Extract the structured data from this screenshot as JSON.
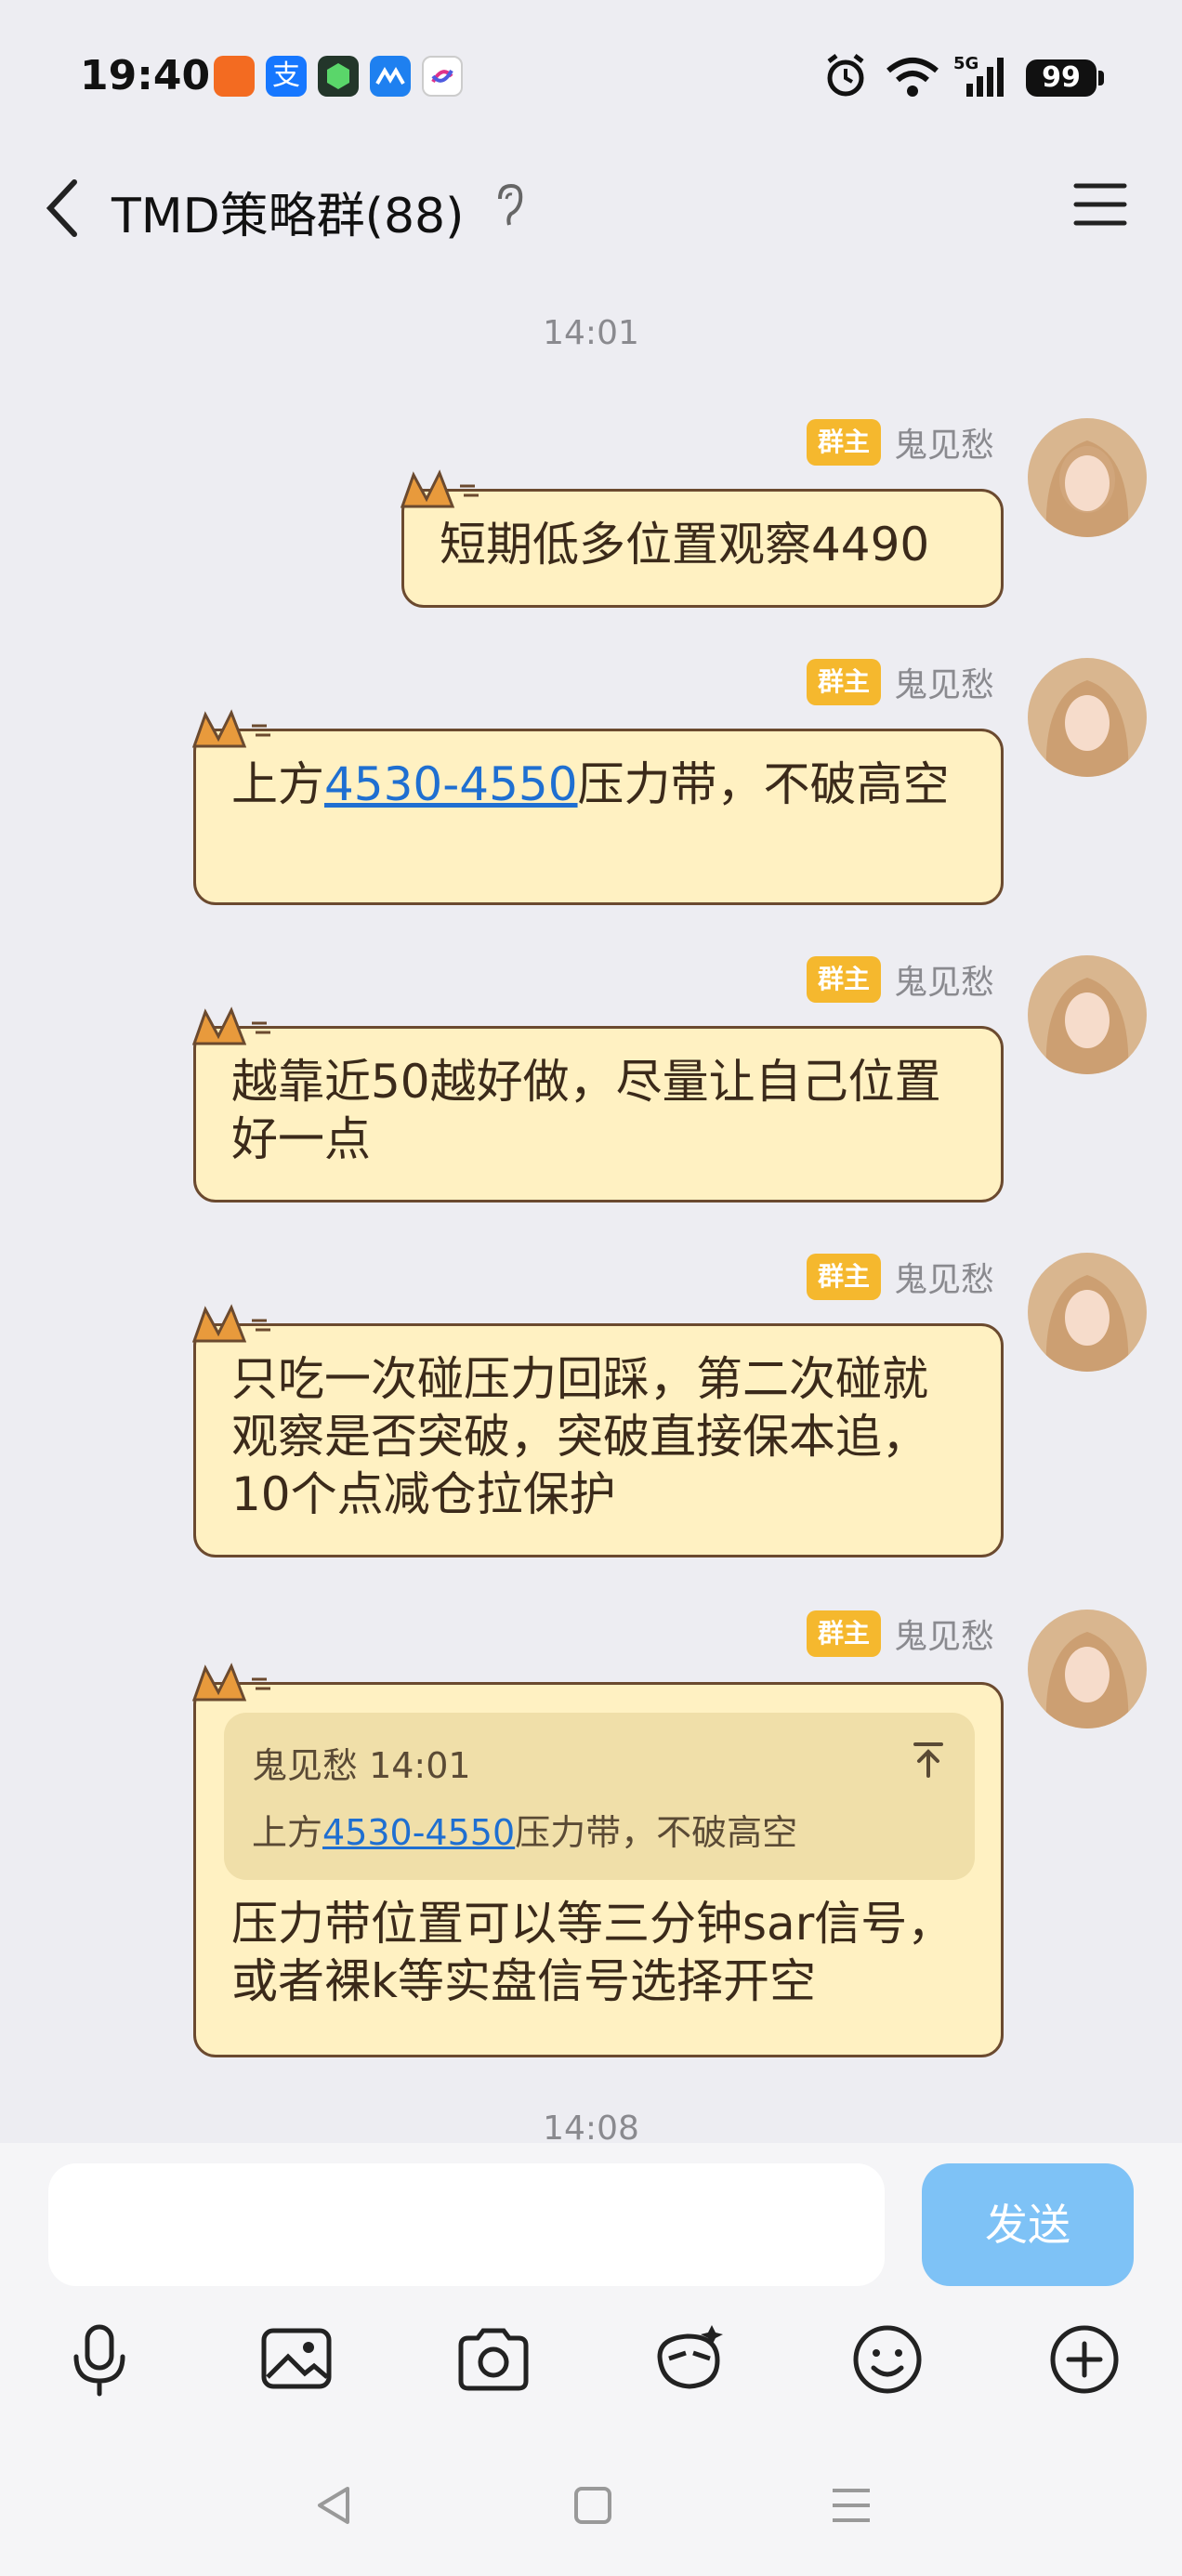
{
  "status_bar": {
    "time": "19:40",
    "app_icons": [
      "taobao-icon",
      "alipay-icon",
      "security-icon",
      "meituan-icon",
      "bank-icon"
    ],
    "battery": "99",
    "network": "5G"
  },
  "header": {
    "title": "TMD策略群(88)"
  },
  "messages": [
    {
      "time_above": "14:01",
      "sender": "鬼见愁",
      "badge": "群主",
      "text": "短期低多位置观察4490"
    },
    {
      "sender": "鬼见愁",
      "badge": "群主",
      "text_before": "上方",
      "link": "4530-4550",
      "text_after": "压力带，不破高空"
    },
    {
      "sender": "鬼见愁",
      "badge": "群主",
      "text": "越靠近50越好做，尽量让自己位置好一点"
    },
    {
      "sender": "鬼见愁",
      "badge": "群主",
      "text": "只吃一次碰压力回踩，第二次碰就观察是否突破，突破直接保本追，10个点减仓拉保护"
    },
    {
      "sender": "鬼见愁",
      "badge": "群主",
      "quote": {
        "header": "鬼见愁 14:01",
        "text_before": "上方",
        "link": "4530-4550",
        "text_after": "压力带，不破高空"
      },
      "text": "压力带位置可以等三分钟sar信号，或者裸k等实盘信号选择开空"
    }
  ],
  "timestamp_bottom": "14:08",
  "composer": {
    "input_value": "",
    "send_label": "发送"
  },
  "toolbar": [
    "microphone-icon",
    "image-icon",
    "camera-icon",
    "sticker-icon",
    "emoji-icon",
    "plus-icon"
  ],
  "colors": {
    "bubble_bg": "#FFF1C2",
    "bubble_border": "#6B4A2F",
    "badge": "#F5B82E",
    "send_button": "#7EC2F6",
    "link": "#1F6FD1"
  }
}
